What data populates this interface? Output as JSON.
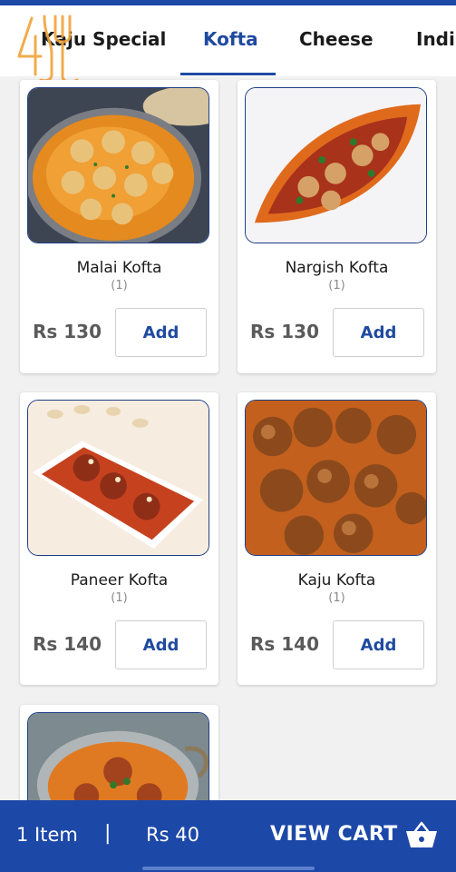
{
  "tabs": [
    {
      "label": "Kaju Special",
      "active": false
    },
    {
      "label": "Kofta",
      "active": true
    },
    {
      "label": "Cheese",
      "active": false
    },
    {
      "label": "Indi",
      "active": false
    }
  ],
  "items": [
    {
      "name": "Malai Kofta",
      "rating": "(1)",
      "price": "Rs 130",
      "add_label": "Add"
    },
    {
      "name": "Nargish Kofta",
      "rating": "(1)",
      "price": "Rs 130",
      "add_label": "Add"
    },
    {
      "name": "Paneer Kofta",
      "rating": "(1)",
      "price": "Rs 140",
      "add_label": "Add"
    },
    {
      "name": "Kaju Kofta",
      "rating": "(1)",
      "price": "Rs 140",
      "add_label": "Add"
    },
    {
      "name": "",
      "rating": "",
      "price": "",
      "add_label": ""
    }
  ],
  "cart": {
    "count": "1 Item",
    "separator": "|",
    "total": "Rs 40",
    "view_label": "VIEW CART"
  },
  "colors": {
    "brand": "#1c48a8",
    "active_tab": "#1f4aa0",
    "logo": "#f0a43a"
  }
}
